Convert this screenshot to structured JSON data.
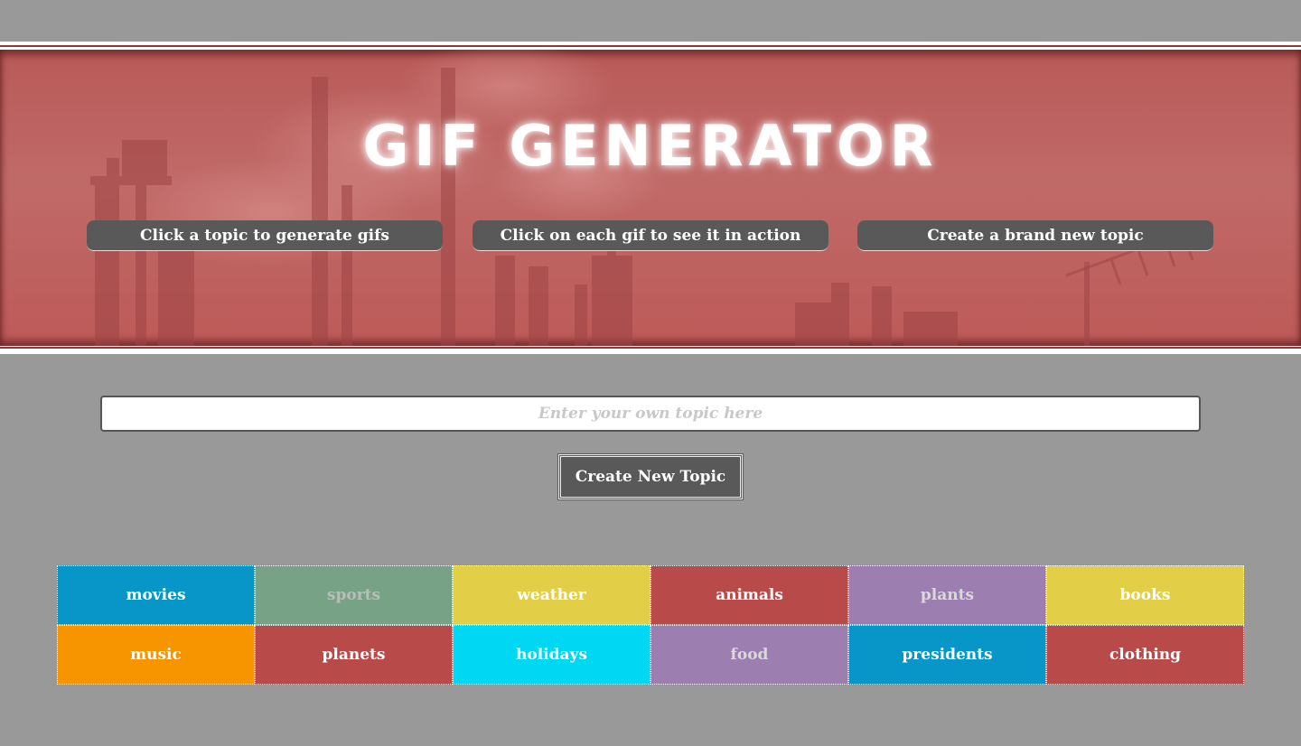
{
  "header": {
    "title": "GIF GENERATOR",
    "tips": [
      "Click a topic to generate gifs",
      "Click on each gif to see it in action",
      "Create a brand new topic"
    ]
  },
  "form": {
    "placeholder": "Enter your own topic here",
    "value": "",
    "button_label": "Create New Topic"
  },
  "topics": [
    {
      "label": "movies",
      "bg": "#0896c9",
      "fg": "#ffffff"
    },
    {
      "label": "sports",
      "bg": "#78a285",
      "fg": "#bcbcbc"
    },
    {
      "label": "weather",
      "bg": "#e2cf47",
      "fg": "#ffffff"
    },
    {
      "label": "animals",
      "bg": "#b84a4a",
      "fg": "#ffffff"
    },
    {
      "label": "plants",
      "bg": "#9c7eb0",
      "fg": "#d9d9d9"
    },
    {
      "label": "books",
      "bg": "#e2cf47",
      "fg": "#ffffff"
    },
    {
      "label": "music",
      "bg": "#f69500",
      "fg": "#ffffff"
    },
    {
      "label": "planets",
      "bg": "#b84a4a",
      "fg": "#ffffff"
    },
    {
      "label": "holidays",
      "bg": "#00d8f3",
      "fg": "#ffffff"
    },
    {
      "label": "food",
      "bg": "#9c7eb0",
      "fg": "#d9d9d9"
    },
    {
      "label": "presidents",
      "bg": "#0896c9",
      "fg": "#ffffff"
    },
    {
      "label": "clothing",
      "bg": "#b84a4a",
      "fg": "#ffffff"
    }
  ],
  "colors": {
    "page_bg": "#999999",
    "hero_red": "#bd5e5c",
    "dark_gray": "#595959"
  }
}
